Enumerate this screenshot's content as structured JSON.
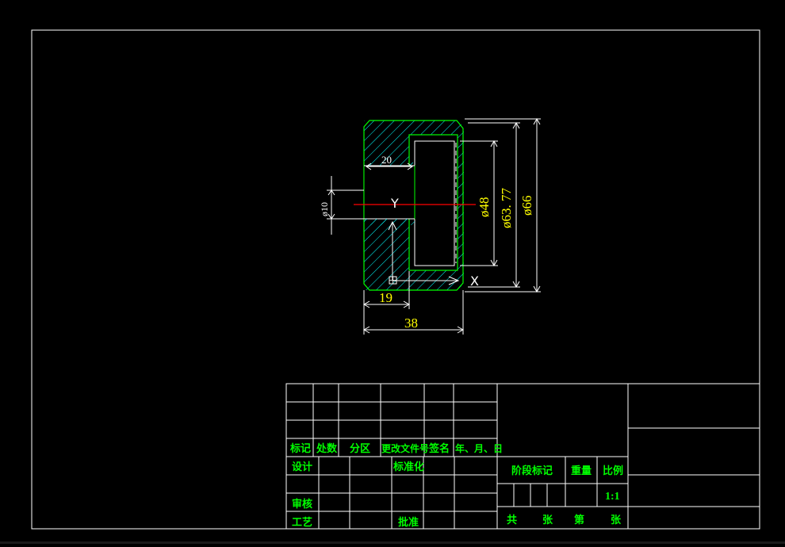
{
  "drawing": {
    "dimensions": {
      "d20": "20",
      "d19": "19",
      "d38": "38",
      "dia10": "ø10",
      "dia48": "ø48",
      "dia63": "ø63. 77",
      "dia66": "ø66"
    },
    "axis_labels": {
      "x": "X",
      "y": "Y"
    }
  },
  "title_block": {
    "rev_headers": {
      "mark": "标记",
      "count": "处数",
      "zone": "分区",
      "doc": "更改文件号",
      "sign": "签名",
      "date": "年、月、日"
    },
    "roles": {
      "design": "设计",
      "standardize": "标准化",
      "review": "审核",
      "process": "工艺",
      "approve": "批准"
    },
    "stage": {
      "stage_mark": "阶段标记",
      "weight": "重量",
      "scale_label": "比例",
      "scale_value": "1:1"
    },
    "sheet": {
      "total": "共",
      "sheets1": "张",
      "page": "第",
      "sheets2": "张"
    }
  },
  "colors": {
    "background": "#000000",
    "frame": "#ffffff",
    "outline": "#00ff00",
    "hatch": "#00ffff",
    "dimension": "#ffff00",
    "centerline": "#ff0000",
    "title_text": "#00ff00"
  }
}
